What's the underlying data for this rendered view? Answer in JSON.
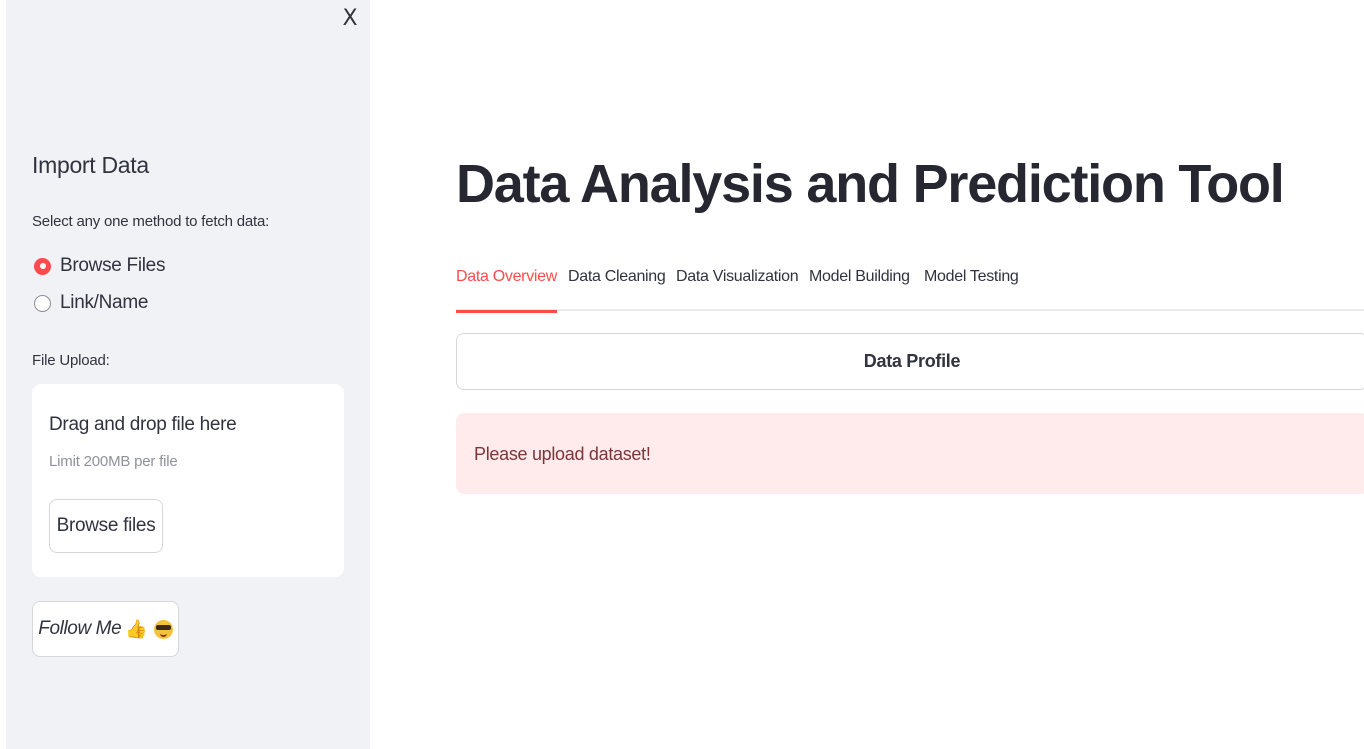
{
  "sidebar": {
    "close_label": "X",
    "heading": "Import Data",
    "method_prompt": "Select any one method to fetch data:",
    "methods": [
      {
        "label": "Browse Files",
        "selected": true
      },
      {
        "label": "Link/Name",
        "selected": false
      }
    ],
    "upload_label": "File Upload:",
    "dropzone": {
      "title": "Drag and drop file here",
      "limit": "Limit 200MB per file",
      "button": "Browse files"
    },
    "follow_button": "Follow Me"
  },
  "main": {
    "title": "Data Analysis and Prediction Tool",
    "tabs": [
      {
        "label": "Data Overview",
        "active": true
      },
      {
        "label": "Data Cleaning",
        "active": false
      },
      {
        "label": "Data Visualization",
        "active": false
      },
      {
        "label": "Model Building",
        "active": false
      },
      {
        "label": "Model Testing",
        "active": false
      }
    ],
    "profile_button": "Data Profile",
    "alert_message": "Please upload dataset!"
  },
  "colors": {
    "accent": "#ff4b4b",
    "sidebar_bg": "#f0f2f6",
    "alert_bg": "#ffebeb",
    "alert_text": "#7d353b"
  },
  "icons": {
    "close": "close-icon",
    "thumbs_up": "thumbs-up-icon",
    "sunglasses_face": "sunglasses-face-icon"
  }
}
